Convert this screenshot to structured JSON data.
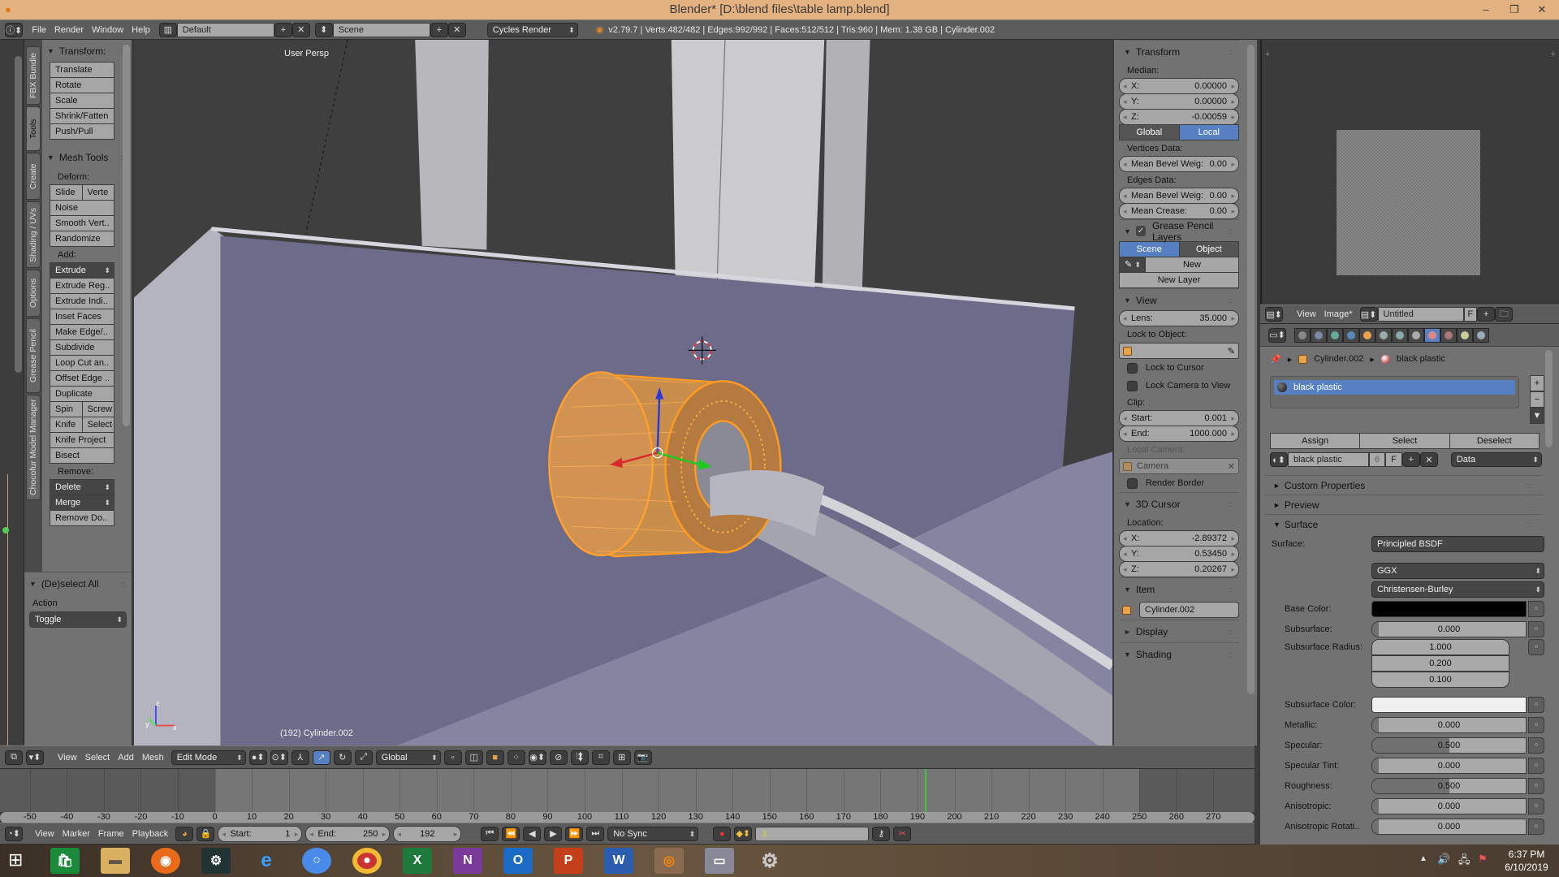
{
  "window": {
    "title": "Blender* [D:\\blend files\\table lamp.blend]",
    "minimize": "–",
    "maximize": "❐",
    "close": "✕"
  },
  "info_header": {
    "menus": [
      "File",
      "Render",
      "Window",
      "Help"
    ],
    "layout": "Default",
    "scene": "Scene",
    "engine": "Cycles Render",
    "stats": "v2.79.7 | Verts:482/482 | Edges:992/992 | Faces:512/512 | Tris:960 | Mem: 1.38 GB | Cylinder.002"
  },
  "tool_tabs": [
    "FBX Bundle",
    "Tools",
    "Create",
    "Shading / UVs",
    "Options",
    "Grease Pencil",
    "Chocofur Model Manager"
  ],
  "toolbar": {
    "rows": [
      {
        "t": "header",
        "text": "Transform:"
      },
      {
        "t": "btn",
        "text": "Translate"
      },
      {
        "t": "btn",
        "text": "Rotate"
      },
      {
        "t": "btn",
        "text": "Scale"
      },
      {
        "t": "btn",
        "text": "Shrink/Fatten"
      },
      {
        "t": "btn",
        "text": "Push/Pull"
      },
      {
        "t": "gap"
      },
      {
        "t": "header",
        "text": "Mesh Tools"
      },
      {
        "t": "label",
        "text": "Deform:"
      },
      {
        "t": "pair",
        "a": "Slide",
        "b": "Verte"
      },
      {
        "t": "btn",
        "text": "Noise"
      },
      {
        "t": "btn",
        "text": "Smooth Vert.."
      },
      {
        "t": "btn",
        "text": "Randomize"
      },
      {
        "t": "label",
        "text": "Add:"
      },
      {
        "t": "drop",
        "text": "Extrude"
      },
      {
        "t": "btn",
        "text": "Extrude Reg.."
      },
      {
        "t": "btn",
        "text": "Extrude Indi.."
      },
      {
        "t": "btn",
        "text": "Inset Faces"
      },
      {
        "t": "btn",
        "text": "Make Edge/.."
      },
      {
        "t": "btn",
        "text": "Subdivide"
      },
      {
        "t": "btn",
        "text": "Loop Cut an.."
      },
      {
        "t": "btn",
        "text": "Offset Edge .."
      },
      {
        "t": "btn",
        "text": "Duplicate"
      },
      {
        "t": "pair",
        "a": "Spin",
        "b": "Screw"
      },
      {
        "t": "pair",
        "a": "Knife",
        "b": "Select"
      },
      {
        "t": "btn",
        "text": "Knife Project"
      },
      {
        "t": "btn",
        "text": "Bisect"
      },
      {
        "t": "label",
        "text": "Remove:"
      },
      {
        "t": "drop",
        "text": "Delete"
      },
      {
        "t": "drop",
        "text": "Merge"
      },
      {
        "t": "btn",
        "text": "Remove Do.."
      }
    ]
  },
  "deselect_panel": {
    "header": "(De)select All",
    "action_label": "Action",
    "action_value": "Toggle"
  },
  "viewport": {
    "view_label": "User Persp",
    "status": "(192) Cylinder.002",
    "gizmo_x": "x",
    "gizmo_y": "y",
    "gizmo_z": "z"
  },
  "npanel": {
    "rows": [
      {
        "t": "header",
        "text": "Transform"
      },
      {
        "t": "label",
        "text": "Median:"
      },
      {
        "t": "num",
        "label": "X:",
        "value": "0.00000"
      },
      {
        "t": "num",
        "label": "Y:",
        "value": "0.00000"
      },
      {
        "t": "num",
        "label": "Z:",
        "value": "-0.00059"
      },
      {
        "t": "tog",
        "a": "Global",
        "b": "Local",
        "active": "b"
      },
      {
        "t": "label",
        "text": "Vertices Data:"
      },
      {
        "t": "num",
        "label": "Mean Bevel Weig:",
        "value": "0.00"
      },
      {
        "t": "label",
        "text": "Edges Data:"
      },
      {
        "t": "num",
        "label": "Mean Bevel Weig:",
        "value": "0.00"
      },
      {
        "t": "num",
        "label": "Mean Crease:",
        "value": "0.00"
      },
      {
        "t": "header",
        "text": "Grease Pencil Layers",
        "check": true
      },
      {
        "t": "tog",
        "a": "Scene",
        "b": "Object",
        "active": "a"
      },
      {
        "t": "newbtn",
        "text": "New"
      },
      {
        "t": "btn",
        "text": "New Layer",
        "center": true
      },
      {
        "t": "header",
        "text": "View"
      },
      {
        "t": "num",
        "label": "Lens:",
        "value": "35.000"
      },
      {
        "t": "label",
        "text": "Lock to Object:"
      },
      {
        "t": "field",
        "text": ""
      },
      {
        "t": "check",
        "text": "Lock to Cursor"
      },
      {
        "t": "check",
        "text": "Lock Camera to View"
      },
      {
        "t": "label",
        "text": "Clip:"
      },
      {
        "t": "num",
        "label": "Start:",
        "value": "0.001"
      },
      {
        "t": "num",
        "label": "End:",
        "value": "1000.000"
      },
      {
        "t": "label",
        "text": "Local Camera:",
        "dim": true
      },
      {
        "t": "field",
        "text": "Camera",
        "dim": true
      },
      {
        "t": "check",
        "text": "Render Border"
      },
      {
        "t": "header",
        "text": "3D Cursor"
      },
      {
        "t": "label",
        "text": "Location:"
      },
      {
        "t": "num",
        "label": "X:",
        "value": "-2.89372"
      },
      {
        "t": "num",
        "label": "Y:",
        "value": "0.53450"
      },
      {
        "t": "num",
        "label": "Z:",
        "value": "0.20267"
      },
      {
        "t": "header",
        "text": "Item"
      },
      {
        "t": "item",
        "text": "Cylinder.002"
      },
      {
        "t": "header",
        "text": "Display",
        "closed": true
      },
      {
        "t": "header",
        "text": "Shading"
      }
    ]
  },
  "image_editor": {
    "menus": [
      "View",
      "Image*"
    ],
    "image_name": "Untitled",
    "fake_user": "F"
  },
  "properties": {
    "context_tabs": [
      "render",
      "render-layers",
      "scene",
      "world",
      "object",
      "constraints",
      "modifiers",
      "data",
      "material",
      "texture",
      "particles",
      "physics"
    ],
    "active_tab": "material",
    "breadcrumb": [
      "Cylinder.002",
      "black plastic"
    ],
    "slots": [
      "black plastic"
    ],
    "slot_buttons": [
      "Assign",
      "Select",
      "Deselect"
    ],
    "material_name": "black plastic",
    "material_users": "6",
    "fake_user": "F",
    "link": "Data",
    "sections": [
      {
        "text": "Custom Properties",
        "open": false
      },
      {
        "text": "Preview",
        "open": false
      },
      {
        "text": "Surface",
        "open": true
      }
    ],
    "surface_label": "Surface:",
    "surface_shader": "Principled BSDF",
    "distribution": "GGX",
    "subsurface_method": "Christensen-Burley",
    "inputs": [
      {
        "label": "Base Color:",
        "kind": "color",
        "color": "#000000"
      },
      {
        "label": "Subsurface:",
        "kind": "slider",
        "value": "0.000",
        "fill": 0
      },
      {
        "label": "Subsurface Radius:",
        "kind": "vector",
        "values": [
          "1.000",
          "0.200",
          "0.100"
        ]
      },
      {
        "label": "Subsurface Color:",
        "kind": "color",
        "color": "#f0f0f0"
      },
      {
        "label": "Metallic:",
        "kind": "slider",
        "value": "0.000",
        "fill": 0
      },
      {
        "label": "Specular:",
        "kind": "slider",
        "value": "0.500",
        "fill": 0.5
      },
      {
        "label": "Specular Tint:",
        "kind": "slider",
        "value": "0.000",
        "fill": 0
      },
      {
        "label": "Roughness:",
        "kind": "slider",
        "value": "0.500",
        "fill": 0.5
      },
      {
        "label": "Anisotropic:",
        "kind": "slider",
        "value": "0.000",
        "fill": 0
      },
      {
        "label": "Anisotropic Rotati..",
        "kind": "slider",
        "value": "0.000",
        "fill": 0
      }
    ]
  },
  "view3d_header": {
    "menus": [
      "View",
      "Select",
      "Add",
      "Mesh"
    ],
    "mode": "Edit Mode",
    "orientation": "Global"
  },
  "timeline": {
    "tick_min": -50,
    "tick_max": 270,
    "tick_step": 10,
    "menus": [
      "View",
      "Marker",
      "Frame",
      "Playback"
    ],
    "start_label": "Start:",
    "start_frame": "1",
    "end_label": "End:",
    "end_frame": "250",
    "current_frame": "192",
    "sync": "No Sync",
    "accent": "#43c443"
  },
  "taskbar": {
    "time": "6:37 PM",
    "date": "6/10/2019"
  }
}
